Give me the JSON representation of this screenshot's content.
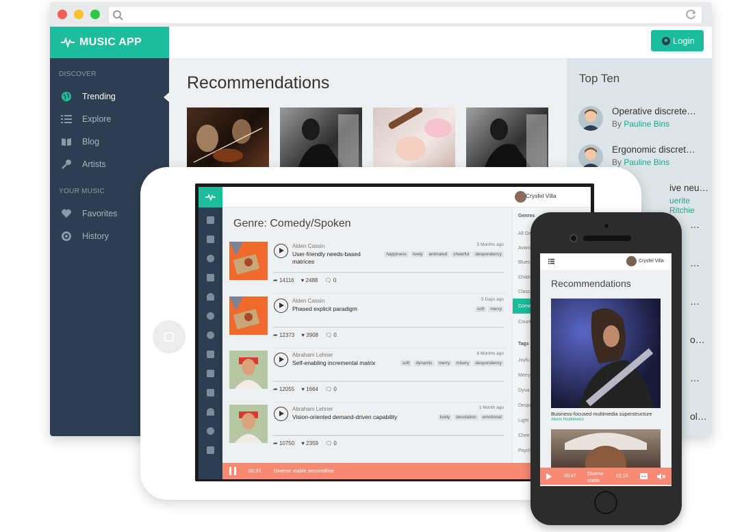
{
  "app": {
    "name": "MUSIC APP",
    "login_label": "Login"
  },
  "sidebar": {
    "discover_heading": "DISCOVER",
    "your_music_heading": "YOUR MUSIC",
    "discover_items": [
      {
        "label": "Trending",
        "icon": "globe-icon",
        "active": true
      },
      {
        "label": "Explore",
        "icon": "list-icon"
      },
      {
        "label": "Blog",
        "icon": "book-icon"
      },
      {
        "label": "Artists",
        "icon": "microphone-icon"
      }
    ],
    "your_music_items": [
      {
        "label": "Favorites",
        "icon": "heart-icon"
      },
      {
        "label": "History",
        "icon": "history-icon"
      }
    ]
  },
  "main": {
    "title": "Recommendations"
  },
  "top_ten": {
    "title": "Top Ten",
    "items": [
      {
        "title": "Operative discrete…",
        "by": "By",
        "author": "Pauline Bins"
      },
      {
        "title": "Ergonomic discret…",
        "by": "By",
        "author": "Pauline Bins"
      },
      {
        "title": "ive neutral …",
        "author": "uerite Ritchie"
      }
    ],
    "fragments": [
      "…",
      "…",
      "…",
      "o…",
      "…",
      "ol…"
    ]
  },
  "tablet": {
    "user": "Crysfel Villa",
    "genre_title": "Genre: Comedy/Spoken",
    "tracks": [
      {
        "artist": "Alden Cassin",
        "title": "User-friendly needs-based matrices",
        "ago": "5 Months ago",
        "tags": [
          "happiness",
          "lively",
          "animated",
          "cheerful",
          "despondency"
        ],
        "plays": "14116",
        "likes": "2488",
        "comments": "0"
      },
      {
        "artist": "Alden Cassin",
        "title": "Phased explicit paradigm",
        "ago": "5 Days ago",
        "tags": [
          "soft",
          "merry"
        ],
        "plays": "12373",
        "likes": "3908",
        "comments": "0"
      },
      {
        "artist": "Abraham Lehner",
        "title": "Self-enabling incremental matrix",
        "ago": "6 Months ago",
        "tags": [
          "soft",
          "dynamic",
          "merry",
          "misery",
          "despondency"
        ],
        "plays": "12055",
        "likes": "1664",
        "comments": "0"
      },
      {
        "artist": "Abraham Lehner",
        "title": "Vision-oriented demand-driven capability",
        "ago": "1 Month ago",
        "tags": [
          "lively",
          "desolation",
          "emotional"
        ],
        "plays": "10750",
        "likes": "2359",
        "comments": "0"
      }
    ],
    "genres_heading": "Genres",
    "genres": [
      "All Ge",
      "Avant",
      "Blues",
      "Childr",
      "Class",
      "Come",
      "Count"
    ],
    "tags_heading": "Tags",
    "tags": [
      "Joyfu",
      "Merry",
      "Dyna",
      "Despo",
      "Light",
      "Chee",
      "Psych"
    ],
    "player": {
      "time": "00:31",
      "track": "Diverse stable securedline"
    }
  },
  "phone": {
    "user": "Crysfel Villa",
    "title": "Recommendations",
    "card_title": "Business-focused multimedia superstructure",
    "card_author": "Alexis Hodkiewicz",
    "player": {
      "elapsed": "00:47",
      "track": "Diverse stable",
      "total": "01:15"
    }
  }
}
